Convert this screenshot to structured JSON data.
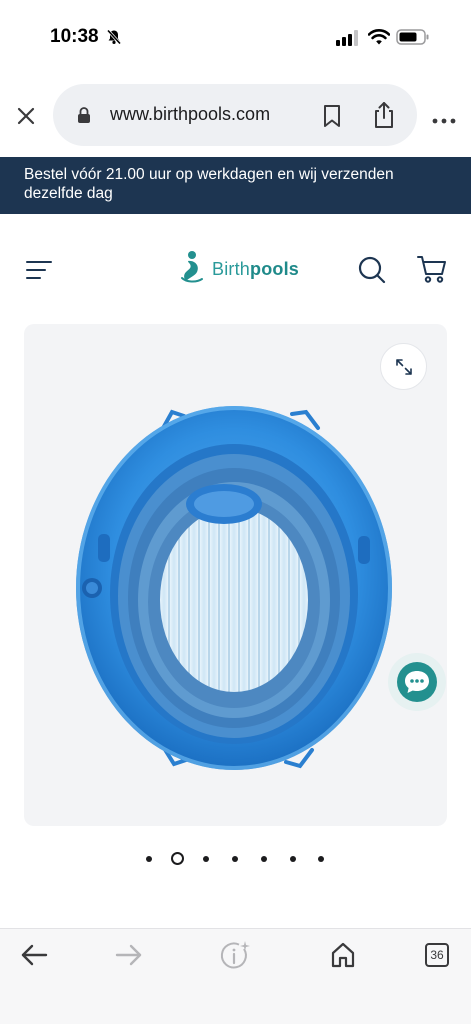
{
  "status_bar": {
    "time": "10:38",
    "icons": [
      "bell-muted-icon",
      "cellular-signal-icon",
      "wifi-icon",
      "battery-icon"
    ]
  },
  "browser": {
    "url": "www.birthpools.com",
    "icons": [
      "close-icon",
      "lock-icon",
      "bookmark-icon",
      "share-icon",
      "more-icon"
    ]
  },
  "announcement": {
    "text": "Bestel vóór 21.00 uur op werkdagen en wij verzenden dezelfde dag"
  },
  "header": {
    "logo_part1": "Birth",
    "logo_part2": "pools",
    "icons": [
      "menu-icon",
      "search-icon",
      "cart-icon"
    ]
  },
  "gallery": {
    "image": "inflatable-birth-pool-image",
    "dot_count": 7,
    "active_dot": 2
  },
  "toolbar": {
    "tab_count": "36",
    "icons": [
      "back-arrow-icon",
      "forward-arrow-icon",
      "info-sparkle-icon",
      "home-icon",
      "tabs-icon"
    ]
  },
  "colors": {
    "banner_bg": "#1d3551",
    "brand_teal": "#23908f",
    "pool_blue": "#2f8ee0"
  }
}
